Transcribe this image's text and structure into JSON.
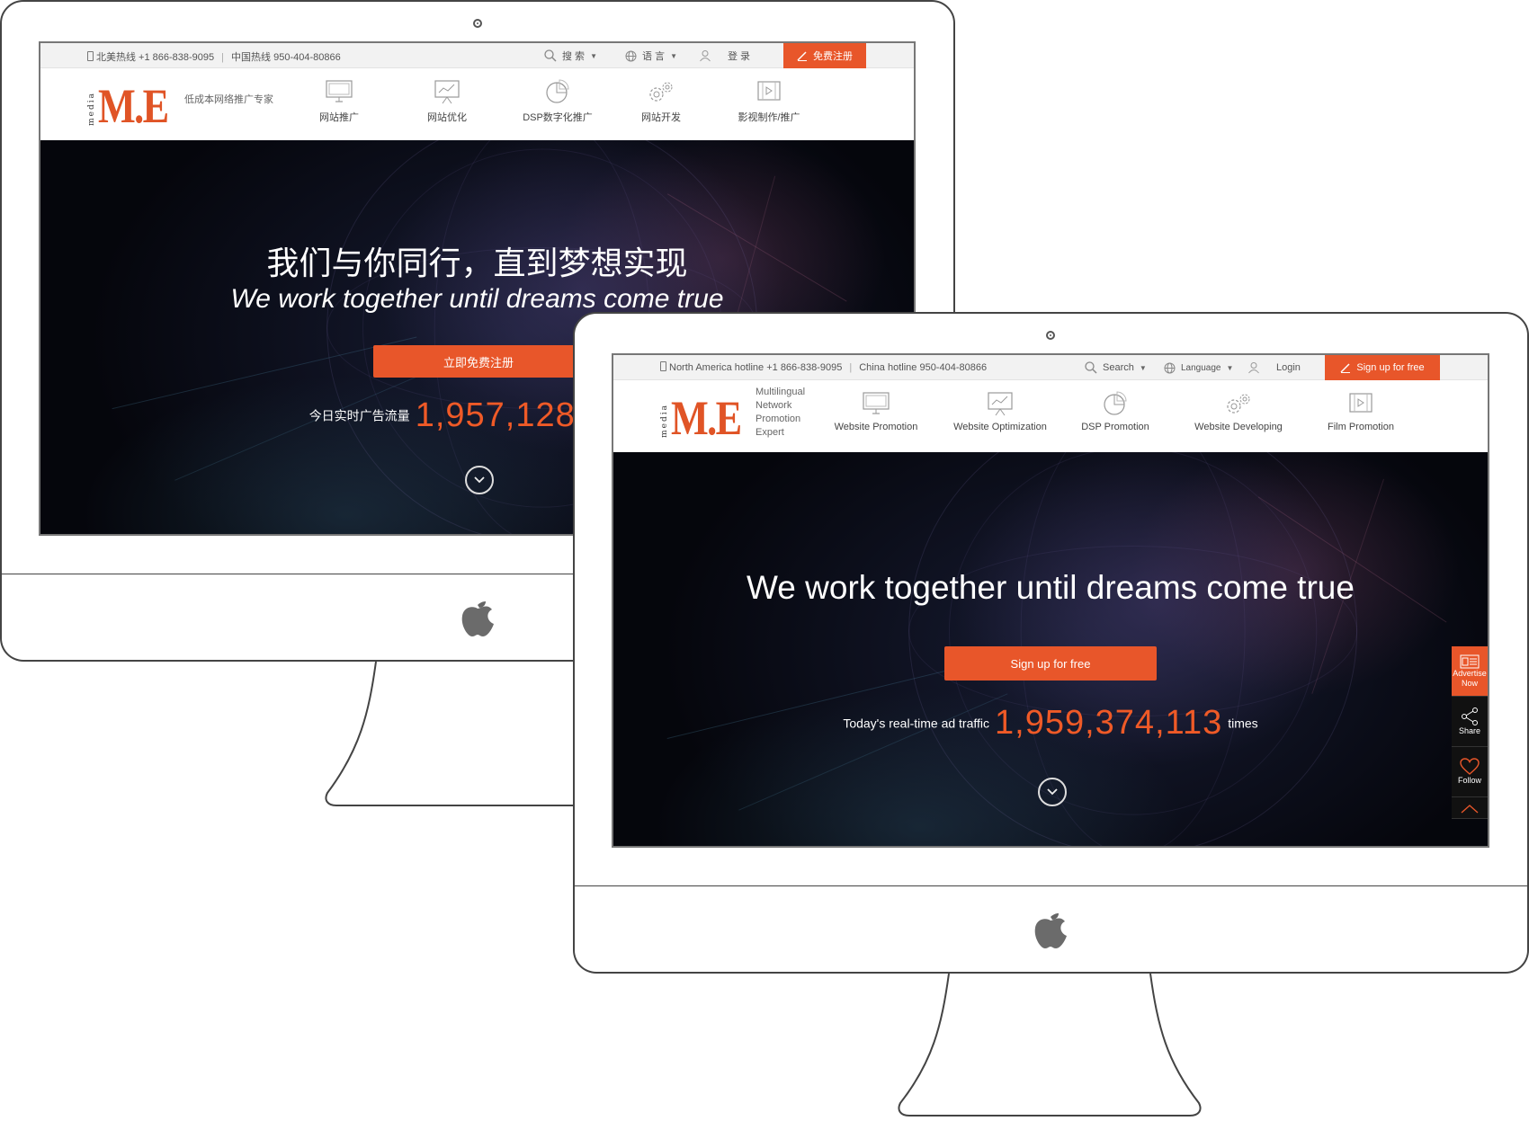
{
  "back_site": {
    "hotline_na": "北美热线 +1 866-838-9095",
    "hotline_cn": "中国热线 950-404-80866",
    "search_label": "搜 索",
    "language_label": "语 言",
    "login_label": "登 录",
    "signup_label": "免费注册",
    "logo_media": "media",
    "logo_text": "M.E",
    "tagline": "低成本网络推广专家",
    "nav": [
      {
        "label": "网站推广"
      },
      {
        "label": "网站优化"
      },
      {
        "label": "DSP数字化推广"
      },
      {
        "label": "网站开发"
      },
      {
        "label": "影视制作/推广"
      }
    ],
    "hero_title_cn": "我们与你同行，直到梦想实现",
    "hero_title_en": "We work together until dreams come true",
    "cta_label": "立即免费注册",
    "traffic_label": "今日实时广告流量",
    "traffic_value": "1,957,128,"
  },
  "front_site": {
    "hotline_na": "North America hotline +1 866-838-9095",
    "hotline_cn": "China hotline 950-404-80866",
    "search_label": "Search",
    "language_label": "Language",
    "login_label": "Login",
    "signup_label": "Sign up for free",
    "logo_media": "media",
    "logo_text": "M.E",
    "tagline_lines": [
      "Multilingual",
      "Network",
      "Promotion",
      "Expert"
    ],
    "nav": [
      {
        "label": "Website Promotion"
      },
      {
        "label": "Website Optimization"
      },
      {
        "label": "DSP Promotion"
      },
      {
        "label": "Website Developing"
      },
      {
        "label": "Film Promotion"
      }
    ],
    "hero_title": "We work together until dreams come true",
    "cta_label": "Sign up for free",
    "traffic_label": "Today's real-time ad traffic",
    "traffic_value": "1,959,374,113",
    "traffic_unit": "times",
    "float_bar": {
      "advertise": "Advertise Now",
      "share": "Share",
      "follow": "Follow"
    }
  },
  "colors": {
    "accent": "#e8562a",
    "traffic_number": "#ef5a27",
    "hero_bg": "#07080d"
  }
}
